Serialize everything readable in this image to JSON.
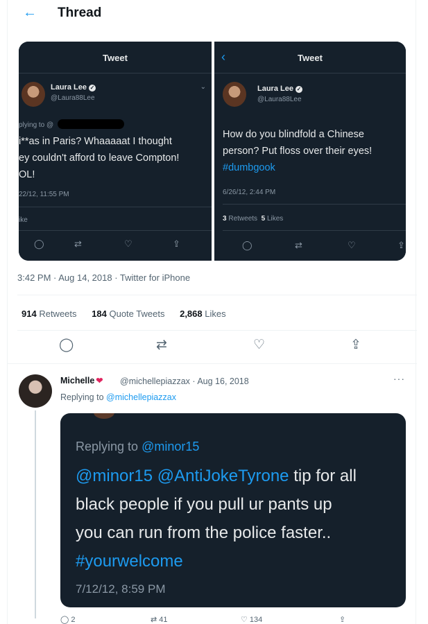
{
  "header": {
    "back_icon": "←",
    "title": "Thread"
  },
  "embedded_image": {
    "left_tweet": {
      "header_title": "Tweet",
      "name": "Laura Lee",
      "handle": "@Laura88Lee",
      "replying_to": "plying to @",
      "lines": [
        "i**as in Paris? Whaaaaat I thought",
        "ey couldn't afford to leave Compton!",
        "OL!"
      ],
      "date": "22/12, 11:55 PM",
      "likes": "ike"
    },
    "right_tweet": {
      "header_title": "Tweet",
      "name": "Laura Lee",
      "handle": "@Laura88Lee",
      "lines": [
        "How do you blindfold a Chinese",
        "person? Put floss over their eyes!"
      ],
      "hashtag": "#dumbgook",
      "date": "6/26/12, 2:44 PM",
      "retweets_count": "3",
      "retweets_label": "Retweets",
      "likes_count": "5",
      "likes_label": "Likes"
    }
  },
  "tweet_meta": {
    "time": "3:42 PM · Aug 14, 2018 · Twitter for iPhone"
  },
  "stats": {
    "retweets_count": "914",
    "retweets_label": "Retweets",
    "quotes_count": "184",
    "quotes_label": "Quote Tweets",
    "likes_count": "2,868",
    "likes_label": "Likes"
  },
  "reply": {
    "name": "Michelle",
    "handle_date": "@michellepiazzax · Aug 16, 2018",
    "more": "···",
    "replying_prefix": "Replying to",
    "replying_handle": "@michellepiazzax",
    "image": {
      "replying_prefix": "Replying to",
      "replying_handle": "@minor15",
      "mentions": "@minor15 @AntiJokeTyrone",
      "line1_rest": " tip for all",
      "line2": "black people if you pull ur pants up",
      "line3": "you can run from the police faster..",
      "hashtag": "#yourwelcome",
      "date": "7/12/12, 8:59 PM"
    },
    "actions": {
      "replies": "2",
      "retweets": "41",
      "likes": "134"
    }
  }
}
